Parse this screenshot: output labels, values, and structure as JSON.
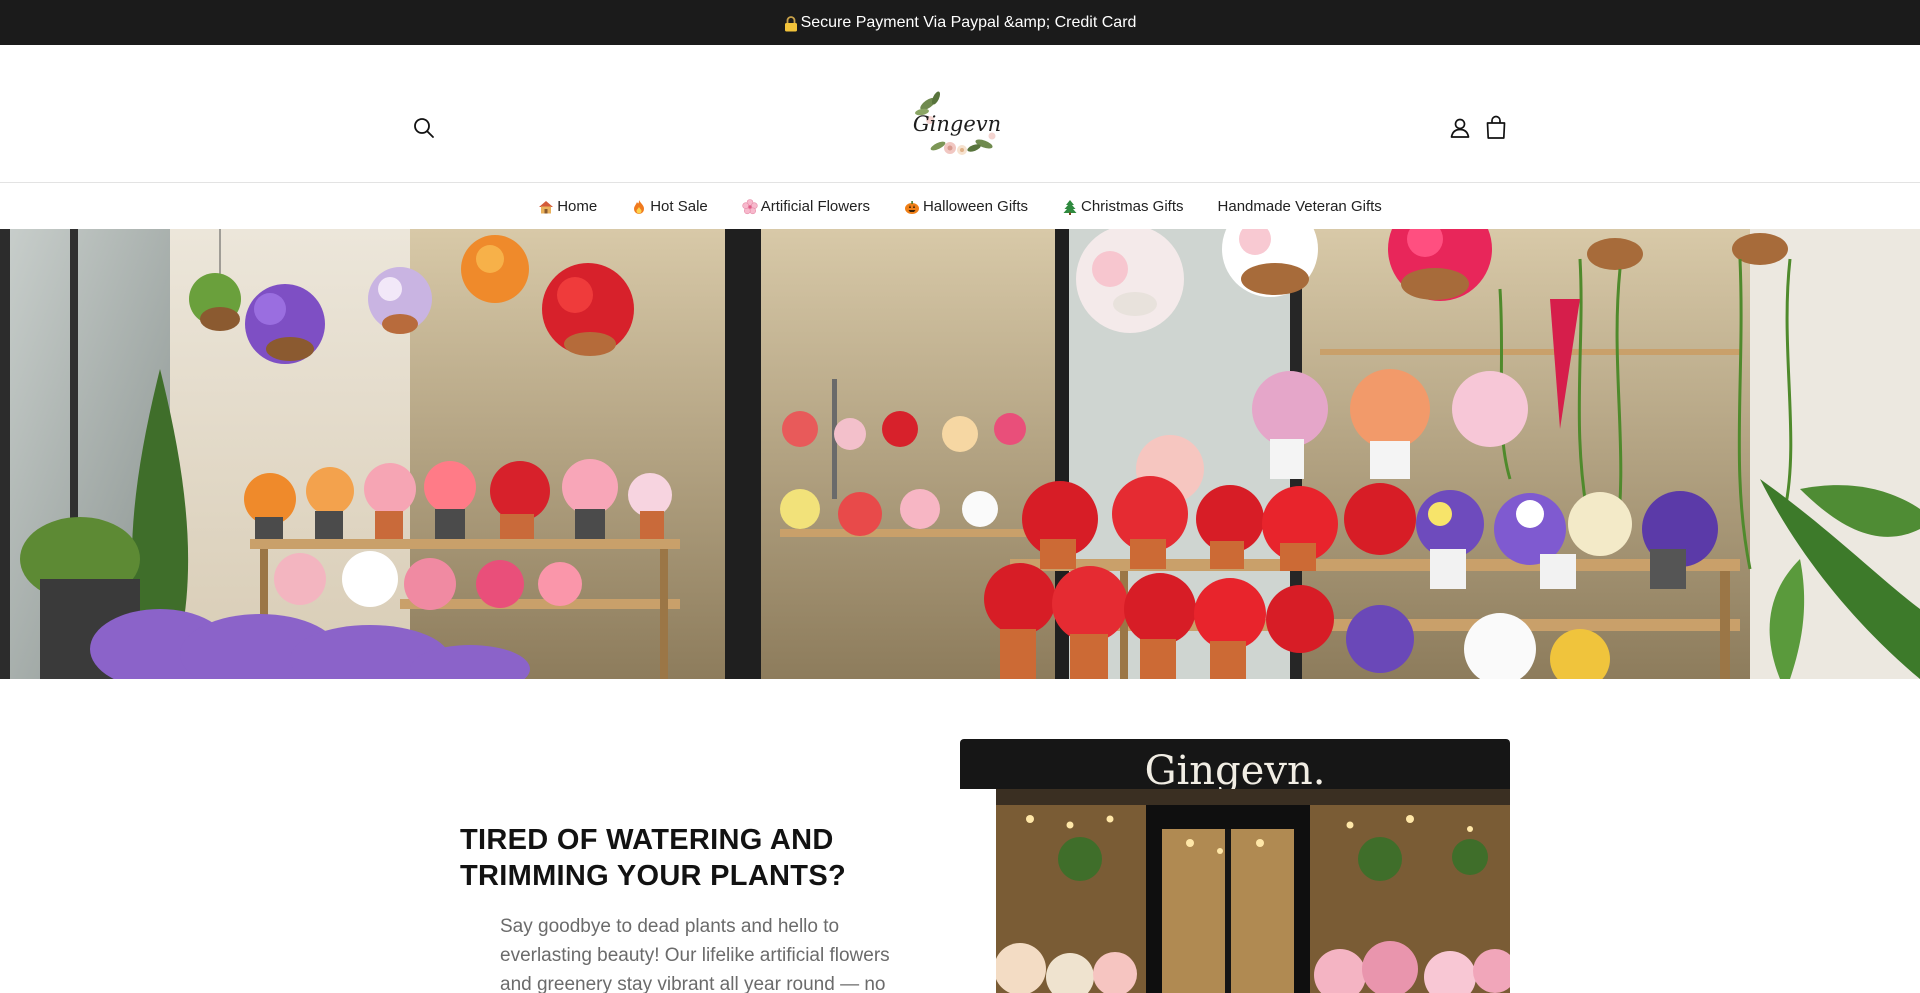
{
  "announcement": {
    "text": "Secure Payment Via Paypal &amp; Credit Card",
    "icon": "lock-icon"
  },
  "header": {
    "logo_text": "Gingevn",
    "icons": [
      "search-icon",
      "account-icon",
      "shopping-bag-icon"
    ]
  },
  "nav": {
    "items": [
      {
        "label": "Home",
        "icon": "house-icon"
      },
      {
        "label": "Hot Sale",
        "icon": "fire-icon"
      },
      {
        "label": "Artificial Flowers",
        "icon": "cherry-blossom-icon"
      },
      {
        "label": "Halloween Gifts",
        "icon": "pumpkin-icon"
      },
      {
        "label": "Christmas Gifts",
        "icon": "christmas-tree-icon"
      },
      {
        "label": "Handmade Veteran Gifts",
        "icon": ""
      }
    ]
  },
  "intro": {
    "heading_line1": "TIRED OF WATERING AND",
    "heading_line2": "TRIMMING YOUR PLANTS?",
    "text": "Say goodbye to dead plants and hello to everlasting beauty! Our lifelike artificial flowers and greenery stay vibrant all year round — no",
    "store_sign": "Gingevn."
  },
  "colors": {
    "announcement_bg": "#1b1b1b",
    "text": "#121212",
    "muted_text": "#6b6b6b",
    "border": "#e3e3e3"
  }
}
